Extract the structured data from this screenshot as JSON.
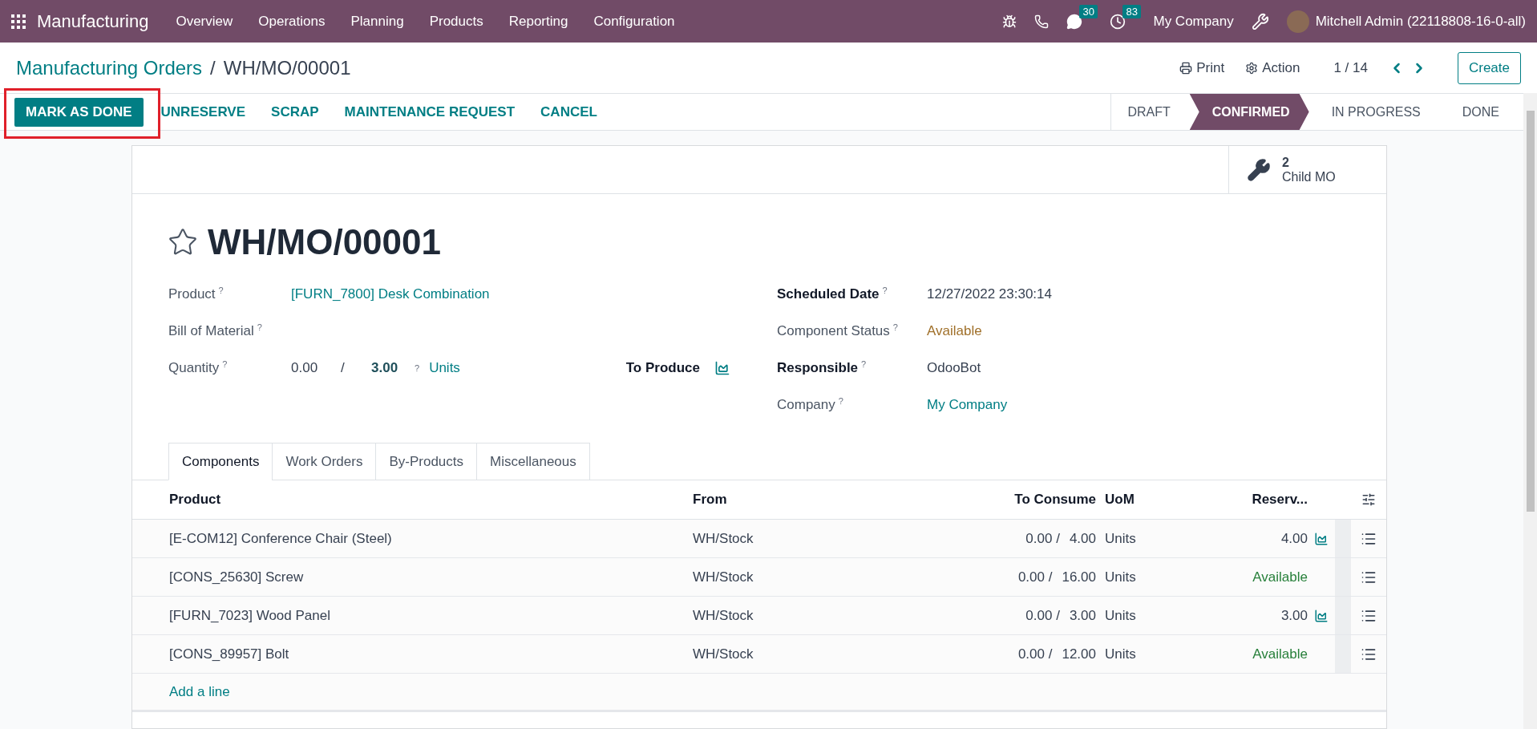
{
  "navbar": {
    "app": "Manufacturing",
    "menu": [
      "Overview",
      "Operations",
      "Planning",
      "Products",
      "Reporting",
      "Configuration"
    ],
    "chat_count": "30",
    "activity_count": "83",
    "company": "My Company",
    "user": "Mitchell Admin (22118808-16-0-all)"
  },
  "breadcrumb": {
    "parent": "Manufacturing Orders",
    "separator": "/",
    "current": "WH/MO/00001"
  },
  "actions": {
    "print": "Print",
    "action": "Action",
    "pager": "1 / 14",
    "create": "Create"
  },
  "buttons": [
    {
      "label": "MARK AS DONE",
      "kind": "primary",
      "highlighted": true
    },
    {
      "label": "UNRESERVE",
      "kind": "link",
      "highlighted": false
    },
    {
      "label": "SCRAP",
      "kind": "link",
      "highlighted": false
    },
    {
      "label": "MAINTENANCE REQUEST",
      "kind": "link",
      "highlighted": false
    },
    {
      "label": "CANCEL",
      "kind": "link",
      "highlighted": false
    }
  ],
  "stages": [
    {
      "label": "DRAFT",
      "selected": false
    },
    {
      "label": "CONFIRMED",
      "selected": true
    },
    {
      "label": "IN PROGRESS",
      "selected": false
    },
    {
      "label": "DONE",
      "selected": false
    }
  ],
  "smart_button": {
    "count": "2",
    "label": "Child MO"
  },
  "record": {
    "title": "WH/MO/00001",
    "starred": false
  },
  "left_fields": [
    {
      "kind": "link",
      "label": "Product",
      "help": "?",
      "value": "[FURN_7800] Desk Combination"
    },
    {
      "kind": "empty",
      "label": "Bill of Material",
      "help": "?"
    },
    {
      "kind": "quantity",
      "label": "Quantity",
      "help": "?",
      "produced": "0.00",
      "separator": "/",
      "planned": "3.00",
      "unit_help": "?",
      "unit": "Units",
      "side_label": "To Produce"
    }
  ],
  "right_fields": [
    {
      "kind": "text",
      "label": "Scheduled Date",
      "bold": true,
      "help": "?",
      "value": "12/27/2022 23:30:14"
    },
    {
      "kind": "status",
      "label": "Component Status",
      "bold": false,
      "help": "?",
      "value": "Available"
    },
    {
      "kind": "text",
      "label": "Responsible",
      "bold": true,
      "help": "?",
      "value": "OdooBot"
    },
    {
      "kind": "link",
      "label": "Company",
      "bold": false,
      "help": "?",
      "value": "My Company"
    }
  ],
  "tabs": [
    {
      "label": "Components",
      "selected": true
    },
    {
      "label": "Work Orders",
      "selected": false
    },
    {
      "label": "By-Products",
      "selected": false
    },
    {
      "label": "Miscellaneous",
      "selected": false
    }
  ],
  "table": {
    "columns": [
      "Product",
      "From",
      "To Consume",
      "UoM",
      "Reserv..."
    ],
    "rows": [
      {
        "kind": "quantity",
        "product": "[E-COM12] Conference Chair (Steel)",
        "from": "WH/Stock",
        "consumed": "0.00 /",
        "to_consume": "4.00",
        "uom": "Units",
        "reserved": "4.00"
      },
      {
        "kind": "available",
        "product": "[CONS_25630] Screw",
        "from": "WH/Stock",
        "consumed": "0.00 /",
        "to_consume": "16.00",
        "uom": "Units",
        "reserved": "Available"
      },
      {
        "kind": "quantity",
        "product": "[FURN_7023] Wood Panel",
        "from": "WH/Stock",
        "consumed": "0.00 /",
        "to_consume": "3.00",
        "uom": "Units",
        "reserved": "3.00"
      },
      {
        "kind": "available",
        "product": "[CONS_89957] Bolt",
        "from": "WH/Stock",
        "consumed": "0.00 /",
        "to_consume": "12.00",
        "uom": "Units",
        "reserved": "Available"
      }
    ],
    "add_line": "Add a line"
  }
}
